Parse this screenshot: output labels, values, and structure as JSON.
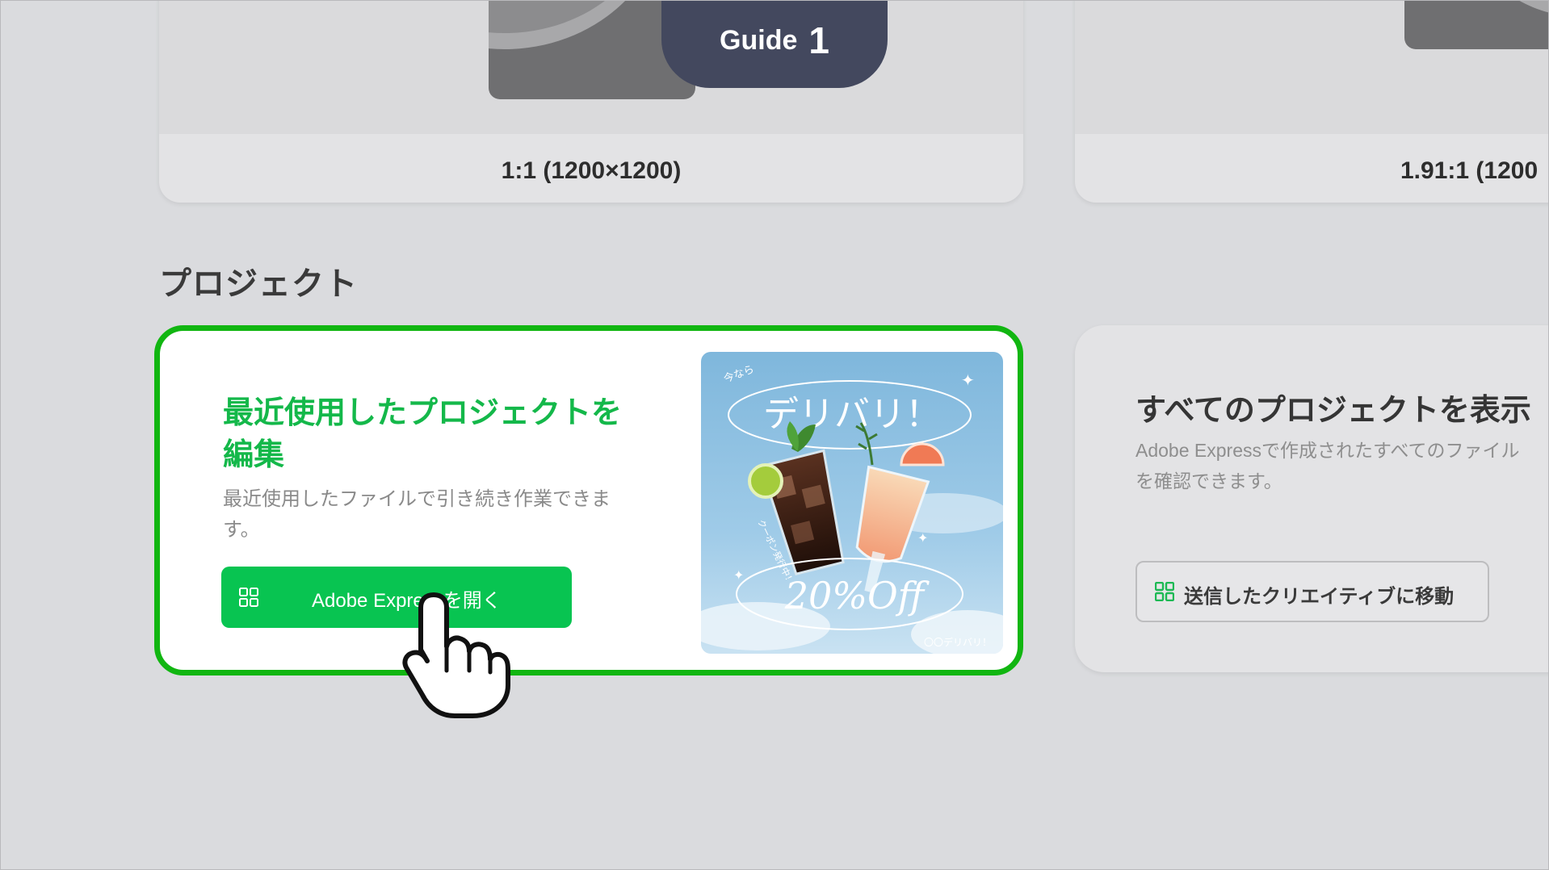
{
  "guide": {
    "label": "Guide",
    "step": "1"
  },
  "size_cards": [
    {
      "label": "1:1 (1200×1200)"
    },
    {
      "label": "1.91:1 (1200"
    }
  ],
  "projects_section": {
    "title": "プロジェクト"
  },
  "recent_project": {
    "title": "最近使用したプロジェクトを編集",
    "description": "最近使用したファイルで引き続き作業できます。",
    "button_label": "Adobe Expressを開く",
    "button_icon": "grid-icon",
    "promo": {
      "top_small": "今なら",
      "headline": "デリバリ！",
      "side_text": "クーポン発行中！",
      "discount": "20%Off",
      "footer": "〇〇デリバリ！"
    }
  },
  "all_projects": {
    "title": "すべてのプロジェクトを表示",
    "description": "Adobe Expressで作成されたすべてのファイルを確認できます。",
    "button_label": "送信したクリエイティブに移動",
    "button_icon": "grid-icon"
  },
  "colors": {
    "accent_green": "#08c451",
    "highlight_border": "#11b611",
    "title_green": "#14b84a",
    "guide_badge": "#43485e"
  }
}
